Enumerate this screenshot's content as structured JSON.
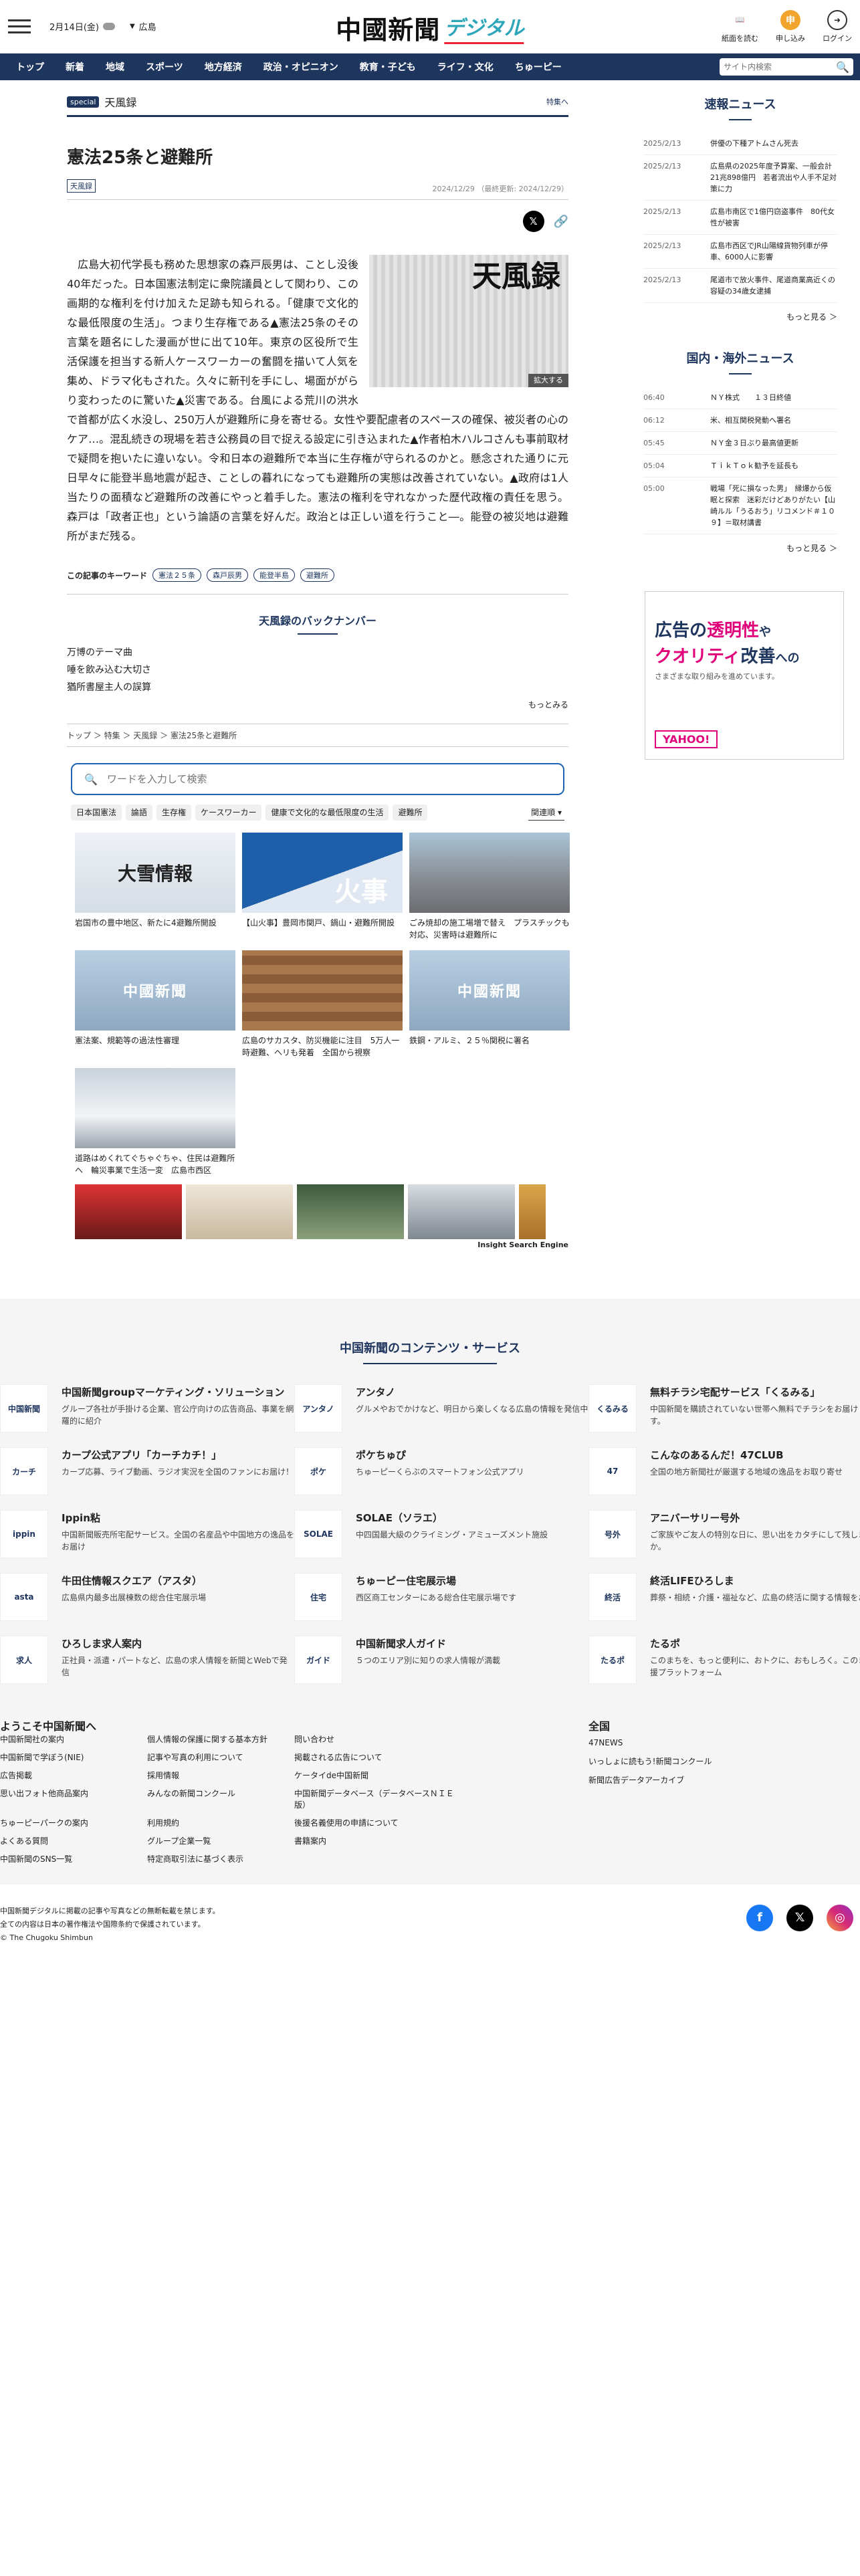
{
  "header": {
    "date": "2月14日(金)",
    "region": "広島",
    "logo_main": "中國新聞",
    "logo_sub": "デジタル",
    "actions": [
      {
        "label": "紙面を読む",
        "icon": "book-icon"
      },
      {
        "label": "申し込み",
        "icon": "apply-icon"
      },
      {
        "label": "ログイン",
        "icon": "login-icon"
      }
    ]
  },
  "nav": {
    "items": [
      "トップ",
      "新着",
      "地域",
      "スポーツ",
      "地方経済",
      "政治・オピニオン",
      "教育・子ども",
      "ライフ・文化",
      "ちゅーピー"
    ],
    "search_placeholder": "サイト内検索"
  },
  "article": {
    "special_badge": "special",
    "series": "天風録",
    "to_special": "特集へ",
    "title": "憲法25条と避難所",
    "tag": "天風録",
    "dates": "2024/12/29 （最終更新: 2024/12/29）",
    "image_label": "天風録",
    "enlarge": "拡大する",
    "body": "広島大初代学長も務めた思想家の森戸辰男は、ことし没後40年だった。日本国憲法制定に衆院議員として関わり、この画期的な権利を付け加えた足跡も知られる。「健康で文化的な最低限度の生活」。つまり生存権である▲憲法25条のその言葉を題名にした漫画が世に出て10年。東京の区役所で生活保護を担当する新人ケースワーカーの奮闘を描いて人気を集め、ドラマ化もされた。久々に新刊を手にし、場面ががらり変わったのに驚いた▲災害である。台風による荒川の洪水で首都が広く水没し、250万人が避難所に身を寄せる。女性や要配慮者のスペースの確保、被災者の心のケア…。混乱続きの現場を若き公務員の目で捉える設定に引き込まれた▲作者柏木ハルコさんも事前取材で疑問を抱いたに違いない。令和日本の避難所で本当に生存権が守られるのかと。懸念された通りに元日早々に能登半島地震が起き、ことしの暮れになっても避難所の実態は改善されていない。▲政府は1人当たりの面積など避難所の改善にやっと着手した。憲法の権利を守れなかった歴代政権の責任を思う。森戸は「政者正也」という論語の言葉を好んだ。政治とは正しい道を行うこと―。能登の被災地は避難所がまだ残る。",
    "keywords_label": "この記事のキーワード",
    "keywords": [
      "憲法２５条",
      "森戸辰男",
      "能登半島",
      "避難所"
    ]
  },
  "backnumber": {
    "title": "天風録のバックナンバー",
    "items": [
      "万博のテーマ曲",
      "唾を飲み込む大切さ",
      "猶所書屋主人の誤算"
    ],
    "more": "もっとみる"
  },
  "breadcrumb": "トップ ＞ 特集 ＞ 天風録 ＞ 憲法25条と避難所",
  "search": {
    "placeholder": "ワードを入力して検索",
    "chips": [
      "日本国憲法",
      "論語",
      "生存権",
      "ケースワーカー",
      "健康で文化的な最低限度の生活",
      "避難所"
    ],
    "sort": "関連順"
  },
  "related": [
    {
      "caption": "岩国市の豊中地区、新たに4避難所開設",
      "img": "snow",
      "overlay": "大雪情報"
    },
    {
      "caption": "【山火事】豊岡市関戸、鍋山・避難所開設",
      "img": "fire",
      "overlay": "火事"
    },
    {
      "caption": "ごみ焼却の施工場増で替え　プラスチックも対応、災害時は避難所に",
      "img": "bldg",
      "overlay": ""
    },
    {
      "caption": "憲法案、規範等の過法性審理",
      "img": "cg",
      "overlay": "中國新聞"
    },
    {
      "caption": "広島のサカスタ、防災機能に注目　5万人一時避難、ヘリも発着　全国から視察",
      "img": "wood",
      "overlay": ""
    },
    {
      "caption": "鉄鋼・アルミ、２５％関税に署名",
      "img": "cg",
      "overlay": "中國新聞"
    },
    {
      "caption": "道路はめくれてぐちゃぐちゃ、住民は避難所へ　輪災事業で生活一変　広島市西区",
      "img": "street",
      "overlay": ""
    }
  ],
  "ise_label": "Insight Search Engine",
  "sidebar": {
    "sokuho_title": "速報ニュース",
    "sokuho": [
      {
        "date": "2025/2/13",
        "text": "併優の下種アトムさん死去"
      },
      {
        "date": "2025/2/13",
        "text": "広島県の2025年度予算案、一般会計21兆898億円　若者流出や人手不足対策に力"
      },
      {
        "date": "2025/2/13",
        "text": "広島市南区で1億円窃盗事件　80代女性が被害"
      },
      {
        "date": "2025/2/13",
        "text": "広島市西区でJR山陽線貨物列車が停車、6000人に影響"
      },
      {
        "date": "2025/2/13",
        "text": "尾道市で放火事件、尾道商業高近くの容疑の34歳女逮捕"
      }
    ],
    "more1": "もっと見る ＞",
    "world_title": "国内・海外ニュース",
    "world": [
      {
        "date": "06:40",
        "text": "ＮＹ株式　　１３日終値"
      },
      {
        "date": "06:12",
        "text": "米、相互関税発動へ署名"
      },
      {
        "date": "05:45",
        "text": "ＮＹ金３日ぶり最高値更新"
      },
      {
        "date": "05:04",
        "text": "ＴｉｋＴｏｋ勧予を延長も"
      },
      {
        "date": "05:00",
        "text": "戦場「死に損なった男」　縁爆から仮眠と探索　迷彩だけどありがたい【山崎ルル「うるおう」リコメンド＃１０９】＝取材講書"
      }
    ],
    "more2": "もっと見る ＞",
    "ad": {
      "line1a": "広告の",
      "line1b": "透明性",
      "line1c": "や",
      "line2a": "クオリティ",
      "line2b": "改善",
      "line2c": "への",
      "line3": "さまざまな取り組みを進めています。",
      "brand": "YAHOO!"
    }
  },
  "services": {
    "title": "中国新聞のコンテンツ・サービス",
    "items": [
      {
        "title": "中国新聞groupマーケティング・ソリューション",
        "desc": "グループ各社が手掛ける企業、官公庁向けの広告商品、事業を網羅的に紹介",
        "icon": "中国新聞"
      },
      {
        "title": "アンタノ",
        "desc": "グルメやおでかけなど、明日から楽しくなる広島の情報を発信中",
        "icon": "アンタノ"
      },
      {
        "title": "無料チラシ宅配サービス「くるみる」",
        "desc": "中国新聞を購読されていない世帯へ無料でチラシをお届けします。",
        "icon": "くるみる"
      },
      {
        "title": "カープ公式アプリ「カーチカチ！」",
        "desc": "カープ応募、ライブ動画、ラジオ実況を全国のファンにお届け！",
        "icon": "カーチ"
      },
      {
        "title": "ポケちゅぴ",
        "desc": "ちゅーピーくらぶのスマートフォン公式アプリ",
        "icon": "ポケ"
      },
      {
        "title": "こんなのあるんだ！47CLUB",
        "desc": "全国の地方新聞社が厳選する地域の逸品をお取り寄せ",
        "icon": "47"
      },
      {
        "title": "Ippin粘",
        "desc": "中国新聞販売所宅配サービス。全国の名産品や中国地方の逸品をお届け",
        "icon": "ippin"
      },
      {
        "title": "SOLAE（ソラエ）",
        "desc": "中四国最大級のクライミング・アミューズメント施設",
        "icon": "SOLAE"
      },
      {
        "title": "アニバーサリー号外",
        "desc": "ご家族やご友人の特別な日に、思い出をカタチにして残しませんか。",
        "icon": "号外"
      },
      {
        "title": "牛田住情報スクエア（アスタ）",
        "desc": "広島県内最多出展棟数の総合住宅展示場",
        "icon": "asta"
      },
      {
        "title": "ちゅーピー住宅展示場",
        "desc": "西区商工センターにある総合住宅展示場です",
        "icon": "住宅"
      },
      {
        "title": "終活LIFEひろしま",
        "desc": "葬祭・相続・介護・福祉など、広島の終活に関する情報をお届け",
        "icon": "終活"
      },
      {
        "title": "ひろしま求人案内",
        "desc": "正社員・派遣・パートなど、広島の求人情報を新聞とWebで発信",
        "icon": "求人"
      },
      {
        "title": "中国新聞求人ガイド",
        "desc": "５つのエリア別に知りの求人情報が満載",
        "icon": "ガイド"
      },
      {
        "title": "たるポ",
        "desc": "このまちを、もっと便利に、おトクに、おもしろく。このまち応援プラットフォーム",
        "icon": "たるポ"
      }
    ]
  },
  "footer": {
    "welcome": "ようこそ中国新聞へ",
    "links": [
      "中国新聞社の案内",
      "個人情報の保護に関する基本方針",
      "問い合わせ",
      "中国新聞で学ぼう(NIE)",
      "記事や写真の利用について",
      "掲載される広告について",
      "広告掲載",
      "採用情報",
      "ケータイde中国新聞",
      "思い出フォト他商品案内",
      "みんなの新聞コンクール",
      "中国新聞データベース（データベースＮＩＥ版）",
      "ちゅーピーパークの案内",
      "利用規約",
      "後援名義使用の申請について",
      "よくある質問",
      "グループ企業一覧",
      "書籍案内",
      "中国新聞のSNS一覧",
      "特定商取引法に基づく表示"
    ],
    "global_title": "全国",
    "global": [
      "47NEWS",
      "いっしょに読もう!新聞コンクール",
      "新聞広告データアーカイブ"
    ],
    "copy1": "中国新聞デジタルに掲載の記事や写真などの無断転載を禁じます。",
    "copy2": "全ての内容は日本の著作権法や国際条約で保護されています。",
    "copy3": "© The Chugoku Shimbun"
  }
}
